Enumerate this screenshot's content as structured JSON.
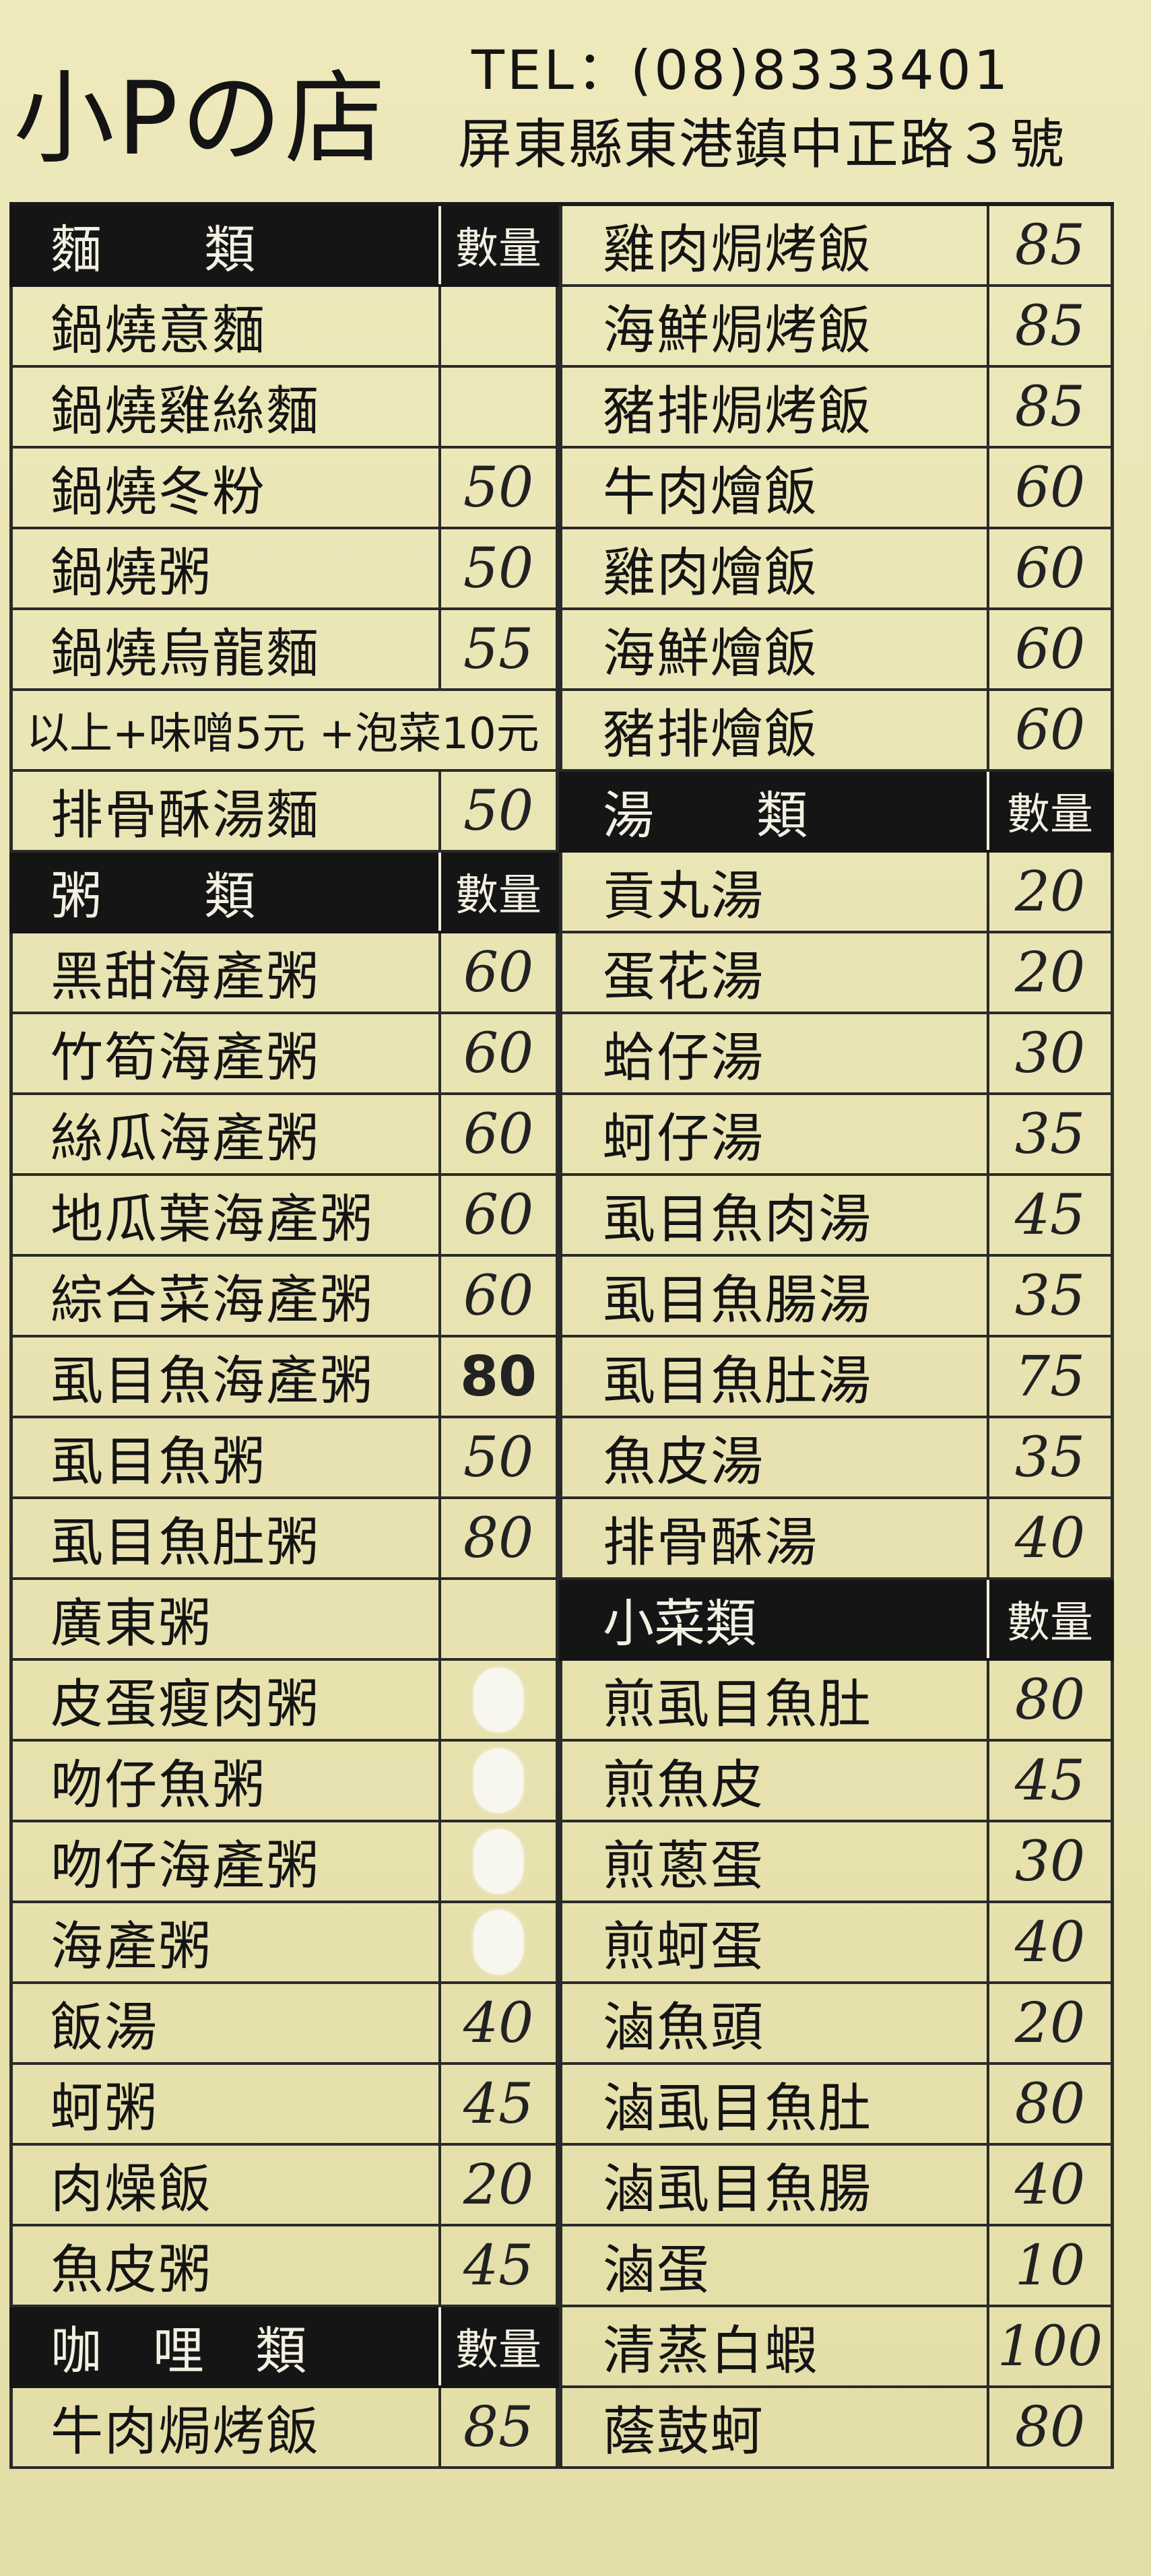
{
  "header": {
    "shop_name": "小Pの店",
    "tel_label": "TEL",
    "tel_sep": "：",
    "tel_number": "(08)8333401",
    "address": "屏東縣東港鎮中正路３號"
  },
  "left_column": [
    {
      "type": "head",
      "name": "麵　　類",
      "price": "數量"
    },
    {
      "name": "鍋燒意麵",
      "price": ""
    },
    {
      "name": "鍋燒雞絲麵",
      "price": ""
    },
    {
      "name": "鍋燒冬粉",
      "price": "50"
    },
    {
      "name": "鍋燒粥",
      "price": "50"
    },
    {
      "name": "鍋燒烏龍麵",
      "price": "55"
    },
    {
      "type": "note",
      "name": "以上+味噌5元 +泡菜10元",
      "price": ""
    },
    {
      "name": "排骨酥湯麵",
      "price": "50"
    },
    {
      "type": "head",
      "name": "粥　　類",
      "price": "數量"
    },
    {
      "name": "黑甜海產粥",
      "price": "60"
    },
    {
      "name": "竹筍海產粥",
      "price": "60"
    },
    {
      "name": "絲瓜海產粥",
      "price": "60"
    },
    {
      "name": "地瓜葉海產粥",
      "price": "60"
    },
    {
      "name": "綜合菜海產粥",
      "price": "60"
    },
    {
      "name": "虱目魚海產粥",
      "price": "80",
      "bold": true
    },
    {
      "name": "虱目魚粥",
      "price": "50"
    },
    {
      "name": "虱目魚肚粥",
      "price": "80"
    },
    {
      "name": "廣東粥",
      "price": ""
    },
    {
      "name": "皮蛋瘦肉粥",
      "price": "",
      "whiteout": true
    },
    {
      "name": "吻仔魚粥",
      "price": "",
      "whiteout": true
    },
    {
      "name": "吻仔海產粥",
      "price": "",
      "whiteout": true
    },
    {
      "name": "海產粥",
      "price": "",
      "whiteout": true
    },
    {
      "name": "飯湯",
      "price": "40"
    },
    {
      "name": "蚵粥",
      "price": "45"
    },
    {
      "name": "肉燥飯",
      "price": "20"
    },
    {
      "name": "魚皮粥",
      "price": "45"
    },
    {
      "type": "head",
      "name": "咖　哩　類",
      "price": "數量"
    },
    {
      "name": "牛肉焗烤飯",
      "price": "85"
    }
  ],
  "right_column": [
    {
      "name": "雞肉焗烤飯",
      "price": "85"
    },
    {
      "name": "海鮮焗烤飯",
      "price": "85"
    },
    {
      "name": "豬排焗烤飯",
      "price": "85"
    },
    {
      "name": "牛肉燴飯",
      "price": "60"
    },
    {
      "name": "雞肉燴飯",
      "price": "60"
    },
    {
      "name": "海鮮燴飯",
      "price": "60"
    },
    {
      "name": "豬排燴飯",
      "price": "60"
    },
    {
      "type": "head",
      "name": "湯　　類",
      "price": "數量"
    },
    {
      "name": "貢丸湯",
      "price": "20"
    },
    {
      "name": "蛋花湯",
      "price": "20"
    },
    {
      "name": "蛤仔湯",
      "price": "30"
    },
    {
      "name": "蚵仔湯",
      "price": "35"
    },
    {
      "name": "虱目魚肉湯",
      "price": "45"
    },
    {
      "name": "虱目魚腸湯",
      "price": "35"
    },
    {
      "name": "虱目魚肚湯",
      "price": "75"
    },
    {
      "name": "魚皮湯",
      "price": "35"
    },
    {
      "name": "排骨酥湯",
      "price": "40"
    },
    {
      "type": "head",
      "name": "小菜類",
      "price": "數量"
    },
    {
      "name": "煎虱目魚肚",
      "price": "80"
    },
    {
      "name": "煎魚皮",
      "price": "45"
    },
    {
      "name": "煎蔥蛋",
      "price": "30"
    },
    {
      "name": "煎蚵蛋",
      "price": "40"
    },
    {
      "name": "滷魚頭",
      "price": "20"
    },
    {
      "name": "滷虱目魚肚",
      "price": "80"
    },
    {
      "name": "滷虱目魚腸",
      "price": "40"
    },
    {
      "name": "滷蛋",
      "price": "10"
    },
    {
      "name": "清蒸白蝦",
      "price": "100"
    },
    {
      "name": "蔭鼓蚵",
      "price": "80"
    }
  ]
}
